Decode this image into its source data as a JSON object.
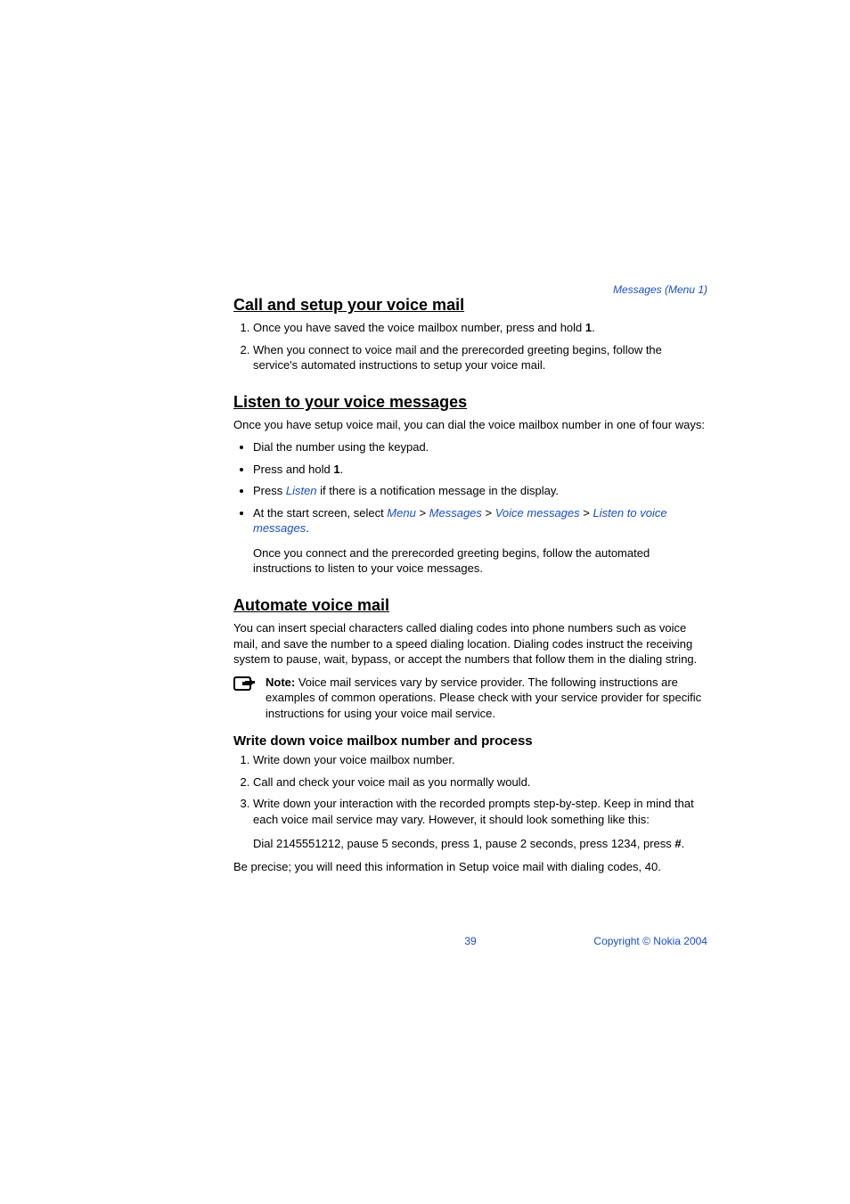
{
  "header": {
    "breadcrumb": "Messages (Menu 1)"
  },
  "section1": {
    "title": "Call and setup your voice mail",
    "step1_a": "Once you have saved the voice mailbox number, press and hold ",
    "step1_key": "1",
    "step1_b": ".",
    "step2": "When you connect to voice mail and the prerecorded greeting begins, follow the service's automated instructions to setup your voice mail."
  },
  "section2": {
    "title": "Listen to your voice messages",
    "intro": "Once you have setup voice mail, you can dial the voice mailbox number in one of four ways:",
    "b1": "Dial the number using the keypad.",
    "b2_a": "Press and hold ",
    "b2_key": "1",
    "b2_b": ".",
    "b3_a": "Press ",
    "b3_link": "Listen",
    "b3_b": " if there is a notification message in the display.",
    "b4_a": "At the start screen, select ",
    "b4_m1": "Menu",
    "b4_sep": " > ",
    "b4_m2": "Messages",
    "b4_m3": "Voice messages",
    "b4_m4": "Listen to voice messages",
    "b4_b": ".",
    "tail": "Once you connect and the prerecorded greeting begins, follow the automated instructions to listen to your voice messages."
  },
  "section3": {
    "title": "Automate voice mail",
    "intro": "You can insert special characters called dialing codes into phone numbers such as voice mail, and save the number to a speed dialing location. Dialing codes instruct the receiving system to pause, wait, bypass, or accept the numbers that follow them in the dialing string.",
    "note_label": "Note:",
    "note_body": " Voice mail services vary by service provider. The following instructions are examples of common operations. Please check with your service provider for specific instructions for using your voice mail service.",
    "sub_title": "Write down voice mailbox number and process",
    "s1": "Write down your voice mailbox number.",
    "s2": "Call and check your voice mail as you normally would.",
    "s3": "Write down your interaction with the recorded prompts step-by-step. Keep in mind that each voice mail service may vary. However, it should look something like this:",
    "s3_ex_a": "Dial 2145551212, pause 5 seconds, press 1, pause 2 seconds, press 1234, press ",
    "s3_ex_key": "#",
    "s3_ex_b": ".",
    "closing": "Be precise; you will need this information in Setup voice mail with dialing codes, 40."
  },
  "footer": {
    "page": "39",
    "copyright": "Copyright © Nokia 2004"
  }
}
